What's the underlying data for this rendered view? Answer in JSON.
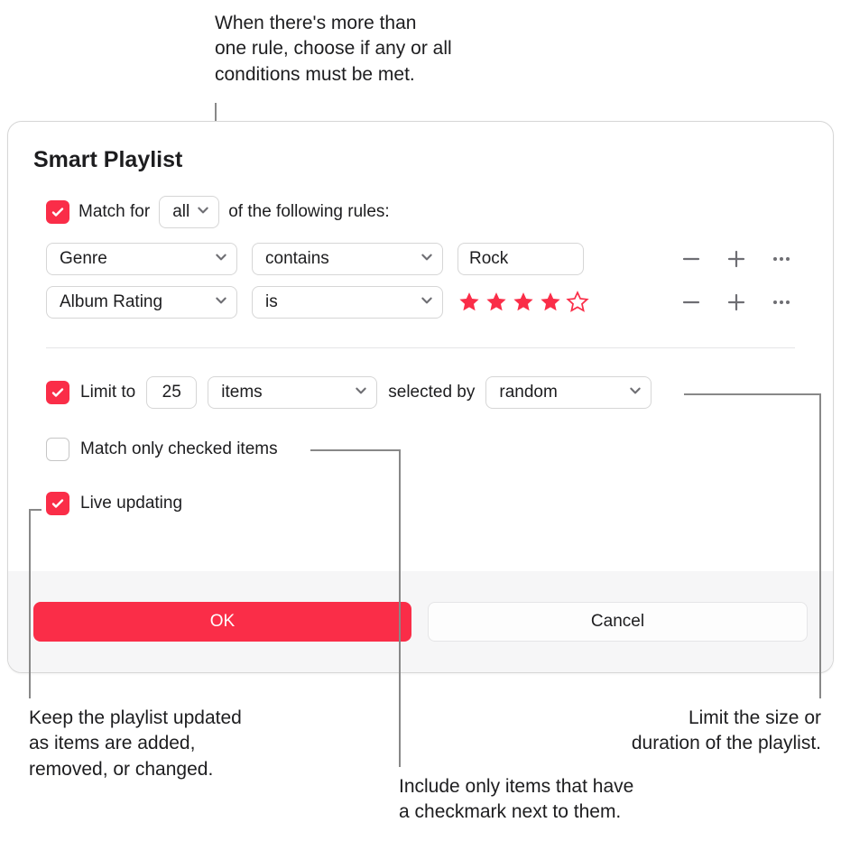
{
  "callouts": {
    "top": "When there's more than\none rule, choose if any or all\nconditions must be met.",
    "live": "Keep the playlist updated\nas items are added,\nremoved, or changed.",
    "checked": "Include only items that have\na checkmark next to them.",
    "limit": "Limit the size or\nduration of the playlist."
  },
  "dialog": {
    "title": "Smart Playlist",
    "match": {
      "prefix": "Match for",
      "mode": "all",
      "suffix": "of the following rules:"
    },
    "rules": [
      {
        "field": "Genre",
        "op": "contains",
        "value_type": "text",
        "value": "Rock"
      },
      {
        "field": "Album Rating",
        "op": "is",
        "value_type": "stars",
        "stars": 4,
        "max_stars": 5
      }
    ],
    "limit": {
      "enabled": true,
      "label": "Limit to",
      "value": "25",
      "unit": "items",
      "selected_by_label": "selected by",
      "selected_by": "random"
    },
    "match_only_checked": {
      "enabled": false,
      "label": "Match only checked items"
    },
    "live_updating": {
      "enabled": true,
      "label": "Live updating"
    },
    "buttons": {
      "ok": "OK",
      "cancel": "Cancel"
    }
  }
}
